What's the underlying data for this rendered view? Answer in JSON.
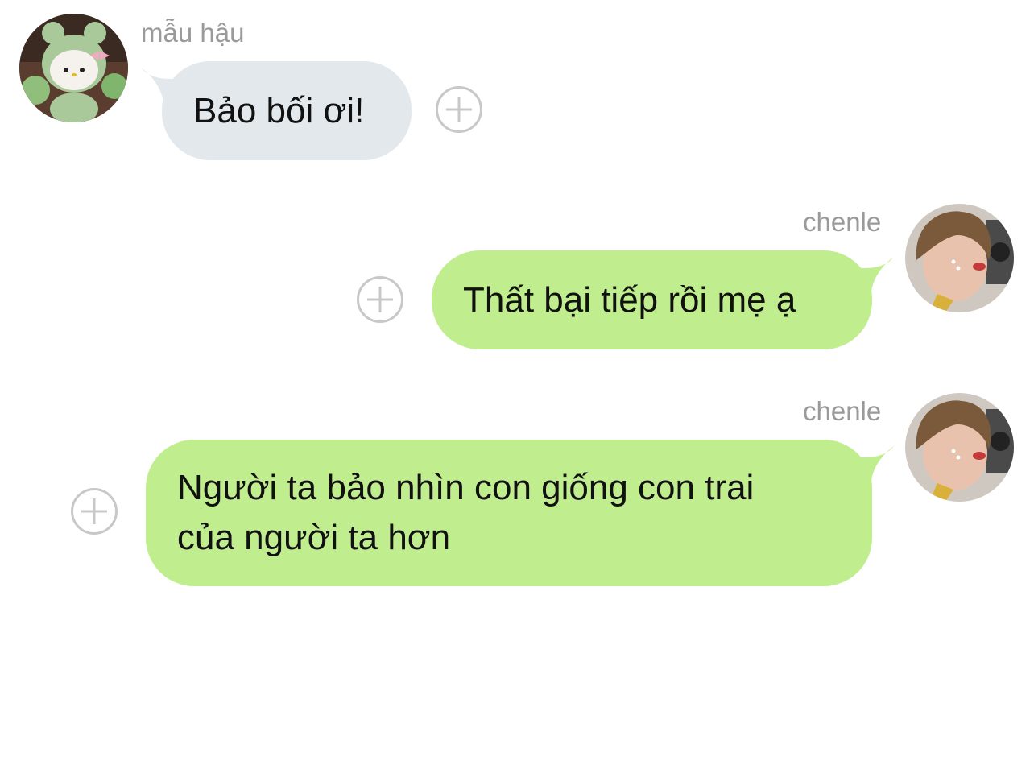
{
  "messages": [
    {
      "sender": "mẫu hậu",
      "side": "left",
      "text": "Bảo bối ơi!"
    },
    {
      "sender": "chenle",
      "side": "right",
      "text": "Thất bại tiếp rồi mẹ ạ"
    },
    {
      "sender": "chenle",
      "side": "right",
      "text_lines": [
        "Người ta bảo nhìn con giống con trai",
        "của người ta hơn"
      ]
    }
  ],
  "colors": {
    "incoming_bubble": "#e3e8ec",
    "outgoing_bubble": "#c0ee8f",
    "sender_name": "#9a9a9a",
    "add_icon": "#c8c8c8"
  },
  "icons": {
    "add": "plus-circle-icon"
  }
}
